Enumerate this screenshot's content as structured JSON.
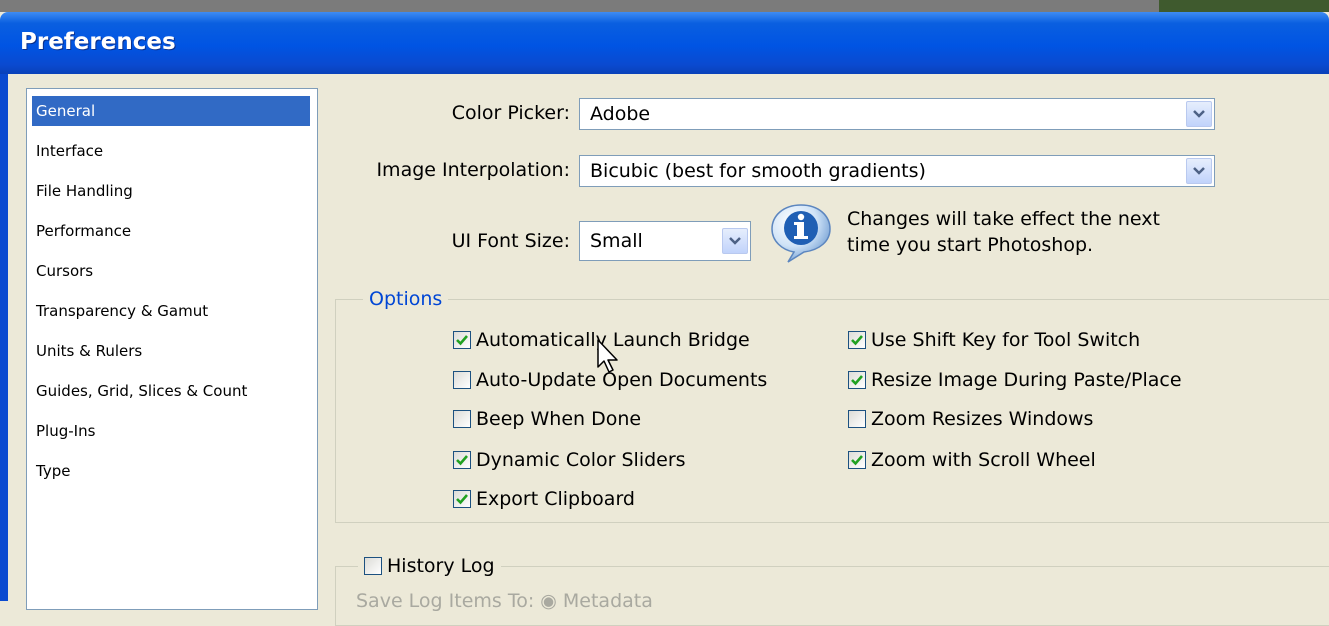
{
  "window": {
    "title": "Preferences"
  },
  "sidebar": {
    "items": [
      {
        "label": "General",
        "selected": true
      },
      {
        "label": "Interface",
        "selected": false
      },
      {
        "label": "File Handling",
        "selected": false
      },
      {
        "label": "Performance",
        "selected": false
      },
      {
        "label": "Cursors",
        "selected": false
      },
      {
        "label": "Transparency & Gamut",
        "selected": false
      },
      {
        "label": "Units & Rulers",
        "selected": false
      },
      {
        "label": "Guides, Grid, Slices & Count",
        "selected": false
      },
      {
        "label": "Plug-Ins",
        "selected": false
      },
      {
        "label": "Type",
        "selected": false
      }
    ]
  },
  "general": {
    "color_picker": {
      "label": "Color Picker:",
      "value": "Adobe"
    },
    "image_interpolation": {
      "label": "Image Interpolation:",
      "value": "Bicubic (best for smooth gradients)"
    },
    "ui_font_size": {
      "label": "UI Font Size:",
      "value": "Small"
    },
    "info": {
      "line1": "Changes will take effect the next",
      "line2": "time you start Photoshop.",
      "icon": "info-icon"
    }
  },
  "options": {
    "title": "Options",
    "left": [
      {
        "label": "Automatically Launch Bridge",
        "checked": true
      },
      {
        "label": "Auto-Update Open Documents",
        "checked": false
      },
      {
        "label": "Beep When Done",
        "checked": false
      },
      {
        "label": "Dynamic Color Sliders",
        "checked": true
      },
      {
        "label": "Export Clipboard",
        "checked": true
      }
    ],
    "right": [
      {
        "label": "Use Shift Key for Tool Switch",
        "checked": true
      },
      {
        "label": "Resize Image During Paste/Place",
        "checked": true
      },
      {
        "label": "Zoom Resizes Windows",
        "checked": false
      },
      {
        "label": "Zoom with Scroll Wheel",
        "checked": true
      }
    ]
  },
  "history_log": {
    "label": "History Log",
    "checked": false,
    "partial_text": "Save Log Items To:  ◉ Metadata"
  },
  "colors": {
    "title_bar": "#0054e3",
    "selection": "#316ac5",
    "options_title": "#0046d5",
    "check": "#21a121"
  }
}
